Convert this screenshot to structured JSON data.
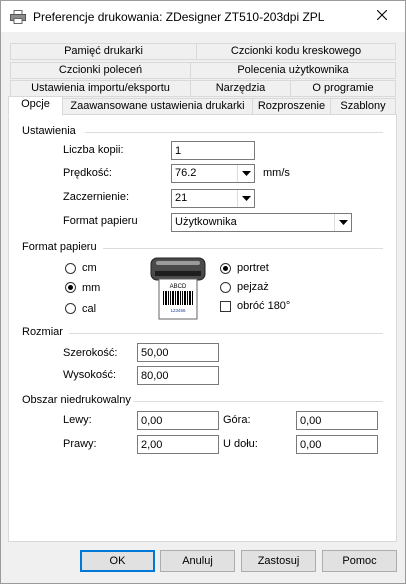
{
  "title": "Preferencje drukowania: ZDesigner ZT510-203dpi ZPL",
  "tabs_row1": [
    "Pamięć drukarki",
    "Czcionki kodu kreskowego"
  ],
  "tabs_row2": [
    "Czcionki poleceń",
    "Polecenia użytkownika"
  ],
  "tabs_row3": [
    "Ustawienia importu/eksportu",
    "Narzędzia",
    "O programie"
  ],
  "tabs_row4": [
    "Opcje",
    "Zaawansowane ustawienia drukarki",
    "Rozproszenie",
    "Szablony"
  ],
  "settings": {
    "group_label": "Ustawienia",
    "copies_label": "Liczba kopii:",
    "copies_value": "1",
    "speed_label": "Prędkość:",
    "speed_value": "76.2",
    "speed_unit": "mm/s",
    "darkness_label": "Zaczernienie:",
    "darkness_value": "21",
    "paper_format_label": "Format papieru",
    "paper_format_value": "Użytkownika"
  },
  "paper_format": {
    "group_label": "Format papieru",
    "unit_cm": "cm",
    "unit_mm": "mm",
    "unit_inch": "cal",
    "selected_unit": "mm",
    "portrait": "portret",
    "landscape": "pejzaż",
    "selected_orientation": "portret",
    "rotate180": "obróć 180°",
    "rotate180_checked": false,
    "preview_label_text": "ABCD",
    "preview_barcode_digits": "123456"
  },
  "size": {
    "group_label": "Rozmiar",
    "width_label": "Szerokość:",
    "width_value": "50,00",
    "height_label": "Wysokość:",
    "height_value": "80,00"
  },
  "margins": {
    "group_label": "Obszar niedrukowalny",
    "left_label": "Lewy:",
    "left_value": "0,00",
    "top_label": "Góra:",
    "top_value": "0,00",
    "right_label": "Prawy:",
    "right_value": "2,00",
    "bottom_label": "U dołu:",
    "bottom_value": "0,00"
  },
  "buttons": {
    "ok": "OK",
    "cancel": "Anuluj",
    "apply": "Zastosuj",
    "help": "Pomoc"
  },
  "icons": {
    "title": "printer-icon",
    "close": "close-icon",
    "dropdown": "chevron-down-icon",
    "preview": "printer-label-preview"
  }
}
